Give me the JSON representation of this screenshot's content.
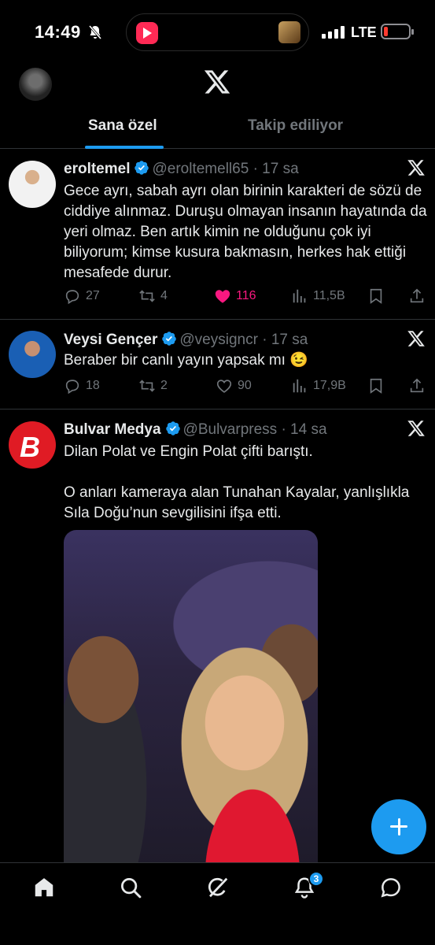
{
  "status_bar": {
    "time": "14:49",
    "network": "LTE",
    "battery_color": "#ff3b30"
  },
  "header": {
    "logo_icon": "x-logo-icon",
    "tabs": [
      {
        "label": "Sana özel",
        "active": true
      },
      {
        "label": "Takip ediliyor",
        "active": false
      }
    ]
  },
  "posts": [
    {
      "name": "eroltemel",
      "verified": true,
      "handle": "@eroltemell65",
      "dot": "·",
      "time": "17 sa",
      "text": [
        "Gece ayrı, sabah ayrı olan birinin karakteri de sözü de ciddiye alınmaz. Duruşu olmayan insanın hayatında da yeri olmaz. Ben artık kimin ne olduğunu çok iyi biliyorum; kimse kusura bakmasın, herkes hak ettiği mesafede durur."
      ],
      "replies": "27",
      "reposts": "4",
      "likes": "116",
      "liked": true,
      "views": "11,5B"
    },
    {
      "name": "Veysi Gençer",
      "verified": true,
      "handle": "@veysigncr",
      "dot": "·",
      "time": "17 sa",
      "text": [
        "Beraber bir canlı yayın yapsak mı 😉"
      ],
      "replies": "18",
      "reposts": "2",
      "likes": "90",
      "liked": false,
      "views": "17,9B"
    },
    {
      "name": "Bulvar Medya",
      "verified": true,
      "handle": "@Bulvarpress",
      "dot": "·",
      "time": "14 sa",
      "avatar_letter": "B",
      "text": [
        "Dilan Polat ve Engin Polat çifti barıştı.",
        "O anları kameraya alan Tunahan Kayalar, yanlışlıkla Sıla Doğu’nun sevgilisini ifşa etti."
      ]
    }
  ],
  "notifications_badge": "3",
  "colors": {
    "accent": "#1d9bf0",
    "like": "#f91880",
    "muted": "#71767b",
    "divider": "#2f3336"
  }
}
